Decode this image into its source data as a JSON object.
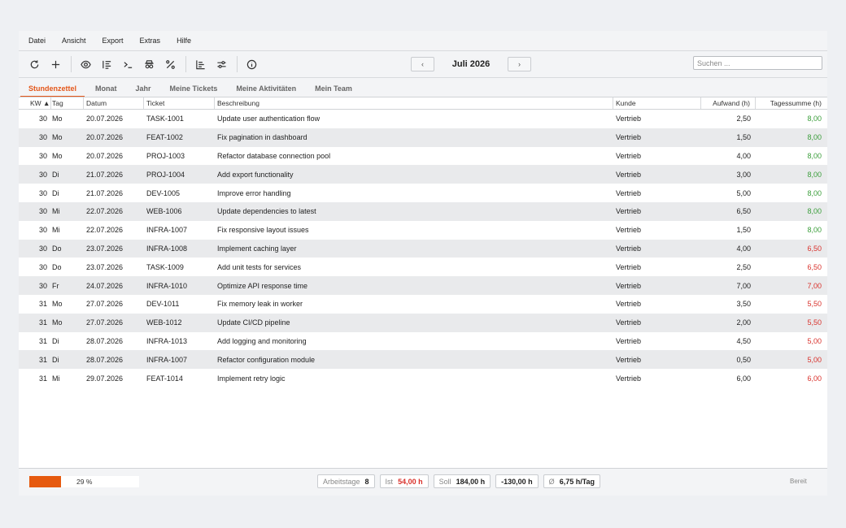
{
  "menu": [
    "Datei",
    "Ansicht",
    "Export",
    "Extras",
    "Hilfe"
  ],
  "toolbar": {
    "icons": [
      "refresh-icon",
      "add-icon",
      "eye-icon",
      "list-icon",
      "terminal-icon",
      "incognito-icon",
      "percent-icon",
      "chart-icon",
      "sliders-icon",
      "info-icon"
    ],
    "prev": "‹",
    "next": "›",
    "month": "Juli 2026",
    "search_placeholder": "Suchen ..."
  },
  "tabs": [
    "Stundenzettel",
    "Monat",
    "Jahr",
    "Meine Tickets",
    "Meine Aktivitäten",
    "Mein Team"
  ],
  "active_tab": 0,
  "columns": {
    "kw": "KW ▲",
    "tag": "Tag",
    "datum": "Datum",
    "ticket": "Ticket",
    "beschreibung": "Beschreibung",
    "kunde": "Kunde",
    "aufwand": "Aufwand (h)",
    "tagessumme": "Tagessumme (h)"
  },
  "rows": [
    {
      "kw": "30",
      "tag": "Mo",
      "datum": "20.07.2026",
      "ticket": "TASK-1001",
      "beschreibung": "Update user authentication flow",
      "kunde": "Vertrieb",
      "aufwand": "2,50",
      "tagessumme": "8,00",
      "status": "ok"
    },
    {
      "kw": "30",
      "tag": "Mo",
      "datum": "20.07.2026",
      "ticket": "FEAT-1002",
      "beschreibung": "Fix pagination in dashboard",
      "kunde": "Vertrieb",
      "aufwand": "1,50",
      "tagessumme": "8,00",
      "status": "ok"
    },
    {
      "kw": "30",
      "tag": "Mo",
      "datum": "20.07.2026",
      "ticket": "PROJ-1003",
      "beschreibung": "Refactor database connection pool",
      "kunde": "Vertrieb",
      "aufwand": "4,00",
      "tagessumme": "8,00",
      "status": "ok"
    },
    {
      "kw": "30",
      "tag": "Di",
      "datum": "21.07.2026",
      "ticket": "PROJ-1004",
      "beschreibung": "Add export functionality",
      "kunde": "Vertrieb",
      "aufwand": "3,00",
      "tagessumme": "8,00",
      "status": "ok"
    },
    {
      "kw": "30",
      "tag": "Di",
      "datum": "21.07.2026",
      "ticket": "DEV-1005",
      "beschreibung": "Improve error handling",
      "kunde": "Vertrieb",
      "aufwand": "5,00",
      "tagessumme": "8,00",
      "status": "ok"
    },
    {
      "kw": "30",
      "tag": "Mi",
      "datum": "22.07.2026",
      "ticket": "WEB-1006",
      "beschreibung": "Update dependencies to latest",
      "kunde": "Vertrieb",
      "aufwand": "6,50",
      "tagessumme": "8,00",
      "status": "ok"
    },
    {
      "kw": "30",
      "tag": "Mi",
      "datum": "22.07.2026",
      "ticket": "INFRA-1007",
      "beschreibung": "Fix responsive layout issues",
      "kunde": "Vertrieb",
      "aufwand": "1,50",
      "tagessumme": "8,00",
      "status": "ok"
    },
    {
      "kw": "30",
      "tag": "Do",
      "datum": "23.07.2026",
      "ticket": "INFRA-1008",
      "beschreibung": "Implement caching layer",
      "kunde": "Vertrieb",
      "aufwand": "4,00",
      "tagessumme": "6,50",
      "status": "under"
    },
    {
      "kw": "30",
      "tag": "Do",
      "datum": "23.07.2026",
      "ticket": "TASK-1009",
      "beschreibung": "Add unit tests for services",
      "kunde": "Vertrieb",
      "aufwand": "2,50",
      "tagessumme": "6,50",
      "status": "under"
    },
    {
      "kw": "30",
      "tag": "Fr",
      "datum": "24.07.2026",
      "ticket": "INFRA-1010",
      "beschreibung": "Optimize API response time",
      "kunde": "Vertrieb",
      "aufwand": "7,00",
      "tagessumme": "7,00",
      "status": "under"
    },
    {
      "kw": "31",
      "tag": "Mo",
      "datum": "27.07.2026",
      "ticket": "DEV-1011",
      "beschreibung": "Fix memory leak in worker",
      "kunde": "Vertrieb",
      "aufwand": "3,50",
      "tagessumme": "5,50",
      "status": "under"
    },
    {
      "kw": "31",
      "tag": "Mo",
      "datum": "27.07.2026",
      "ticket": "WEB-1012",
      "beschreibung": "Update CI/CD pipeline",
      "kunde": "Vertrieb",
      "aufwand": "2,00",
      "tagessumme": "5,50",
      "status": "under"
    },
    {
      "kw": "31",
      "tag": "Di",
      "datum": "28.07.2026",
      "ticket": "INFRA-1013",
      "beschreibung": "Add logging and monitoring",
      "kunde": "Vertrieb",
      "aufwand": "4,50",
      "tagessumme": "5,00",
      "status": "under"
    },
    {
      "kw": "31",
      "tag": "Di",
      "datum": "28.07.2026",
      "ticket": "INFRA-1007",
      "beschreibung": "Refactor configuration module",
      "kunde": "Vertrieb",
      "aufwand": "0,50",
      "tagessumme": "5,00",
      "status": "under"
    },
    {
      "kw": "31",
      "tag": "Mi",
      "datum": "29.07.2026",
      "ticket": "FEAT-1014",
      "beschreibung": "Implement retry logic",
      "kunde": "Vertrieb",
      "aufwand": "6,00",
      "tagessumme": "6,00",
      "status": "under"
    }
  ],
  "status_colors": {
    "ok": "#3b9e3b",
    "under": "#d9322c",
    "accent": "#e4571a",
    "progress": "#e65a0f"
  },
  "statusbar": {
    "progress_fraction": 0.29,
    "progress_label": "29 %",
    "arbeitstage_label": "Arbeitstage",
    "arbeitstage_value": "8",
    "ist_label": "Ist",
    "ist_value": "54,00 h",
    "soll_label": "Soll",
    "soll_value": "184,00 h",
    "diff_value": "-130,00 h",
    "avg_label": "Ø",
    "avg_value": "6,75 h/Tag",
    "status": "Bereit"
  }
}
